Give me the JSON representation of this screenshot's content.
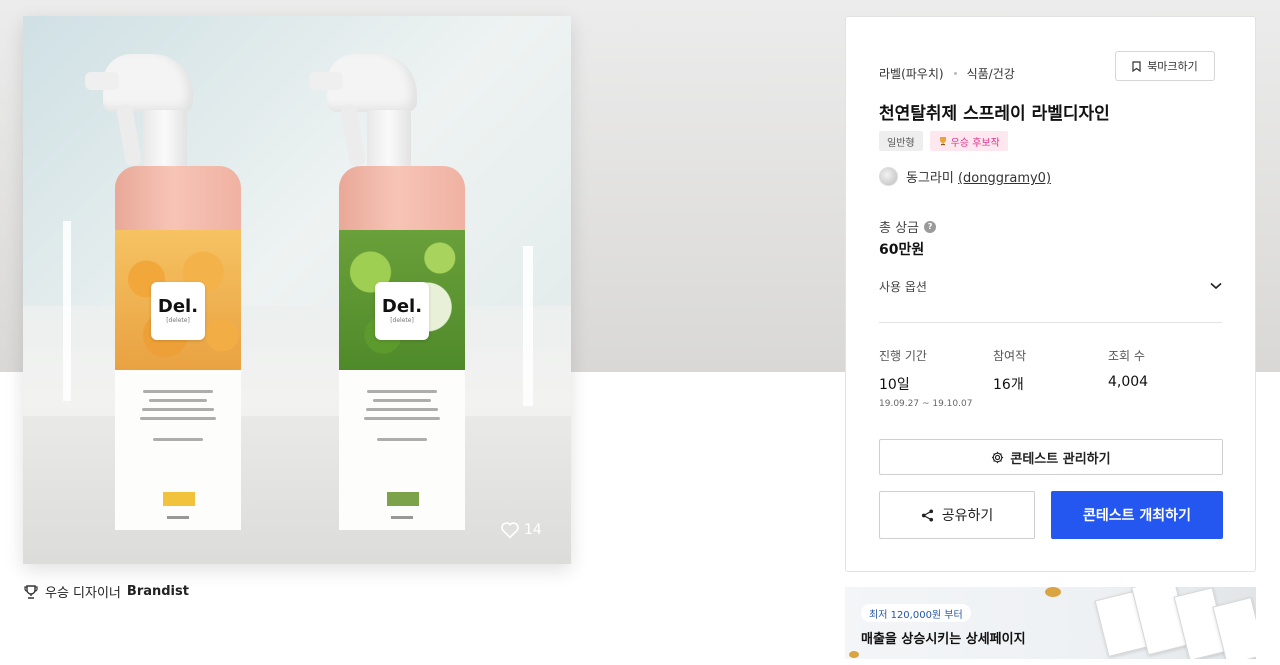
{
  "product": {
    "brand_text": "Del.",
    "brand_sub": "[delete]"
  },
  "likes": {
    "count": "14",
    "icon": "heart-icon"
  },
  "winner": {
    "label": "우승 디자이너",
    "name": "Brandist",
    "icon": "trophy-icon"
  },
  "panel": {
    "breadcrumbs": [
      "라벨(파우치)",
      "식품/건강"
    ],
    "bookmark_label": "북마크하기",
    "title": "천연탈취제 스프레이 라벨디자인",
    "badges": {
      "type": "일반형",
      "candidate": "우승 후보작"
    },
    "designer": {
      "name": "동그라미",
      "id": "(donggramy0)"
    },
    "prize": {
      "label": "총 상금",
      "value": "60만원"
    },
    "options_label": "사용 옵션",
    "stats": {
      "period": {
        "label": "진행 기간",
        "value": "10일",
        "range": "19.09.27 ~ 19.10.07"
      },
      "participants": {
        "label": "참여작",
        "value": "16개"
      },
      "views": {
        "label": "조회 수",
        "value": "4,004"
      }
    },
    "manage_button": "콘테스트 관리하기",
    "share_button": "공유하기",
    "host_button": "콘테스트 개최하기"
  },
  "ad": {
    "pill": "최저 120,000원 부터",
    "headline": "매출을 상승시키는 상세페이지"
  },
  "colors": {
    "primary": "#2456f0",
    "candidate_badge_text": "#e0338a",
    "candidate_badge_bg": "#fde8f0"
  }
}
